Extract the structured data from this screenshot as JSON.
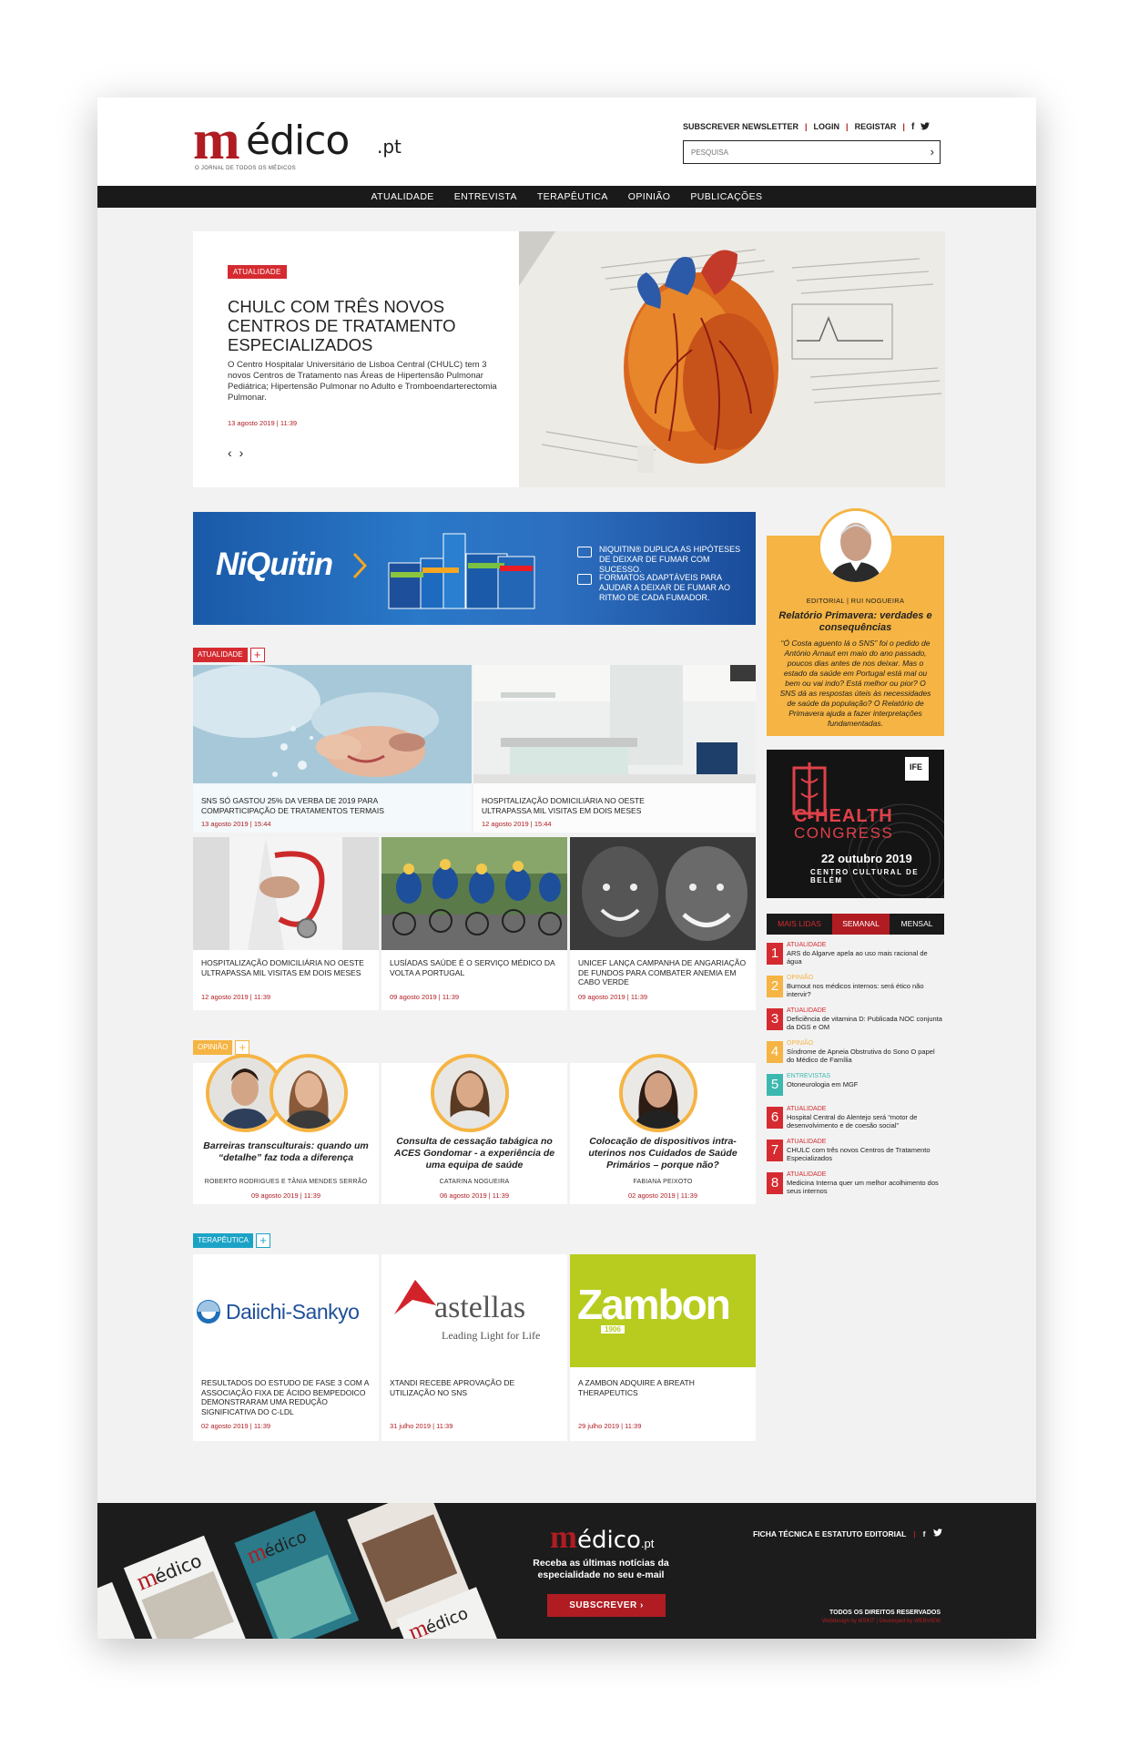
{
  "logo": {
    "m": "m",
    "name": "édico",
    "suffix": ".pt",
    "tagline": "O JORNAL DE TODOS OS MÉDICOS"
  },
  "toplinks": {
    "newsletter": "SUBSCREVER NEWSLETTER",
    "login": "LOGIN",
    "register": "REGISTAR",
    "sep": "|"
  },
  "search": {
    "placeholder": "PESQUISA"
  },
  "nav": [
    "ATUALIDADE",
    "ENTREVISTA",
    "TERAPÊUTICA",
    "OPINIÃO",
    "PUBLICAÇÕES"
  ],
  "hero": {
    "tag": "ATUALIDADE",
    "title": "CHULC COM TRÊS NOVOS CENTROS DE TRATAMENTO ESPECIALIZADOS",
    "text": "O Centro Hospitalar Universitário de Lisboa Central (CHULC) tem 3 novos Centros de Tratamento nas Áreas de Hipertensão Pulmonar Pediátrica; Hipertensão Pulmonar no Adulto e Tromboendarterectomia Pulmonar.",
    "date": "13 agosto 2019 | 11:39",
    "prev": "‹",
    "next": "›"
  },
  "banner": {
    "brand": "NiQuitin",
    "line1": "NIQUITIN® DUPLICA AS HIPÓTESES DE DEIXAR DE FUMAR COM SUCESSO.",
    "line2": "FORMATOS ADAPTÁVEIS PARA AJUDAR A DEIXAR DE FUMAR AO RITMO DE CADA FUMADOR."
  },
  "editorial": {
    "label": "EDITORIAL | RUI NOGUEIRA",
    "title": "Relatório Primavera: verdades e consequências",
    "text": "“Ó Costa aguento lá o SNS” foi o pedido de António Arnaut em maio do ano passado, poucos dias antes de nos deixar. Mas o estado da saúde em Portugal está mal ou bem ou vai indo? Está melhor ou pior? O SNS dá as respostas úteis às necessidades de saúde da população? O Relatório de Primavera ajuda a fazer interpretações fundamentadas."
  },
  "chealth": {
    "ife": "IFE",
    "title1": "C-HEALTH",
    "title2": "CONGRESS",
    "date": "22 outubro 2019",
    "venue": "CENTRO CULTURAL DE BELÉM"
  },
  "atualidade": {
    "label": "ATUALIDADE",
    "plus": "+",
    "top": [
      {
        "title": "SNS SÓ GASTOU 25% DA VERBA DE 2019 PARA COMPARTICIPAÇÃO DE TRATAMENTOS TERMAIS",
        "date": "13 agosto 2019 | 15:44"
      },
      {
        "title": "HOSPITALIZAÇÃO DOMICILIÁRIA NO OESTE ULTRAPASSA MIL VISITAS EM DOIS MESES",
        "date": "12 agosto 2019 | 15:44"
      }
    ],
    "bottom": [
      {
        "title": "HOSPITALIZAÇÃO DOMICILIÁRIA NO OESTE ULTRAPASSA MIL VISITAS EM DOIS MESES",
        "date": "12 agosto 2019 | 11:39"
      },
      {
        "title": "LUSÍADAS SAÚDE É O SERVIÇO MÉDICO DA VOLTA A PORTUGAL",
        "date": "09 agosto 2019 | 11:39"
      },
      {
        "title": "UNICEF LANÇA CAMPANHA DE ANGARIAÇÃO DE FUNDOS PARA COMBATER ANEMIA EM CABO VERDE",
        "date": "09 agosto 2019 | 11:39"
      }
    ]
  },
  "opiniao": {
    "label": "OPINIÃO",
    "plus": "+",
    "items": [
      {
        "title": "Barreiras transculturais: quando um “detalhe” faz toda a diferença",
        "author": "ROBERTO RODRIGUES E TÂNIA MENDES SERRÃO",
        "date": "09 agosto 2019 | 11:39"
      },
      {
        "title": "Consulta de cessação tabágica no ACES Gondomar - a experiência de uma equipa de saúde",
        "author": "CATARINA NOGUEIRA",
        "date": "06 agosto 2019 | 11:39"
      },
      {
        "title": "Colocação de dispositivos intra-uterinos nos Cuidados de Saúde Primários – porque não?",
        "author": "FABIANA PEIXOTO",
        "date": "02 agosto 2019 | 11:39"
      }
    ]
  },
  "mostread": {
    "tabs": [
      "MAIS LIDAS",
      "SEMANAL",
      "MENSAL"
    ],
    "items": [
      {
        "n": "1",
        "cat": "ATUALIDADE",
        "text": "ARS do Algarve apela ao uso mais racional de água",
        "color": "#d52b30"
      },
      {
        "n": "2",
        "cat": "OPINIÃO",
        "text": "Burnout nos médicos internos: será ético não intervir?",
        "color": "#f5b443"
      },
      {
        "n": "3",
        "cat": "ATUALIDADE",
        "text": "Deficiência de vitamina D: Publicada NOC conjunta da DGS e OM",
        "color": "#d52b30"
      },
      {
        "n": "4",
        "cat": "OPINIÃO",
        "text": "Síndrome de Apneia Obstrutiva do Sono O papel do Médico de Família",
        "color": "#f5b443"
      },
      {
        "n": "5",
        "cat": "ENTREVISTAS",
        "text": "Otoneurologia em MGF",
        "color": "#3cb8b0"
      },
      {
        "n": "6",
        "cat": "ATUALIDADE",
        "text": "Hospital Central do Alentejo será “motor de desenvolvimento e de coesão social”",
        "color": "#d52b30"
      },
      {
        "n": "7",
        "cat": "ATUALIDADE",
        "text": "CHULC com três novos Centros de Tratamento Especializados",
        "color": "#d52b30"
      },
      {
        "n": "8",
        "cat": "ATUALIDADE",
        "text": "Medicina Interna quer um melhor acolhimento dos seus internos",
        "color": "#d52b30"
      }
    ]
  },
  "terapeutica": {
    "label": "TERAPÊUTICA",
    "plus": "+",
    "items": [
      {
        "brand": "Daiichi-Sankyo",
        "title": "RESULTADOS DO ESTUDO DE FASE 3 COM A ASSOCIAÇÃO FIXA DE ÁCIDO BEMPEDOICO DEMONSTRARAM UMA REDUÇÃO SIGNIFICATIVA DO C-LDL",
        "date": "02 agosto 2019 | 11:39"
      },
      {
        "brand": "astellas",
        "tagline": "Leading Light for Life",
        "title": "XTANDI RECEBE APROVAÇÃO DE UTILIZAÇÃO NO SNS",
        "date": "31 julho 2019 | 11:39"
      },
      {
        "brand": "Zambon",
        "year": "1906",
        "title": "A ZAMBON ADQUIRE A BREATH THERAPEUTICS",
        "date": "29 julho 2019 | 11:39"
      }
    ]
  },
  "footer": {
    "text": "Receba as últimas notícias da especialidade no seu e-mail",
    "button": "SUBSCREVER",
    "link": "FICHA TÉCNICA E ESTATUTO EDITORIAL",
    "rights": "TODOS OS DIREITOS RESERVADOS",
    "dev": "Webdesign by MSKIT | Developed by WEBVIEW"
  },
  "colors": {
    "brand": "#b01c22",
    "atualidade": "#d52b30",
    "opiniao": "#f5b443",
    "terapeutica": "#1ba3c6",
    "dark": "#1a1a1a"
  }
}
